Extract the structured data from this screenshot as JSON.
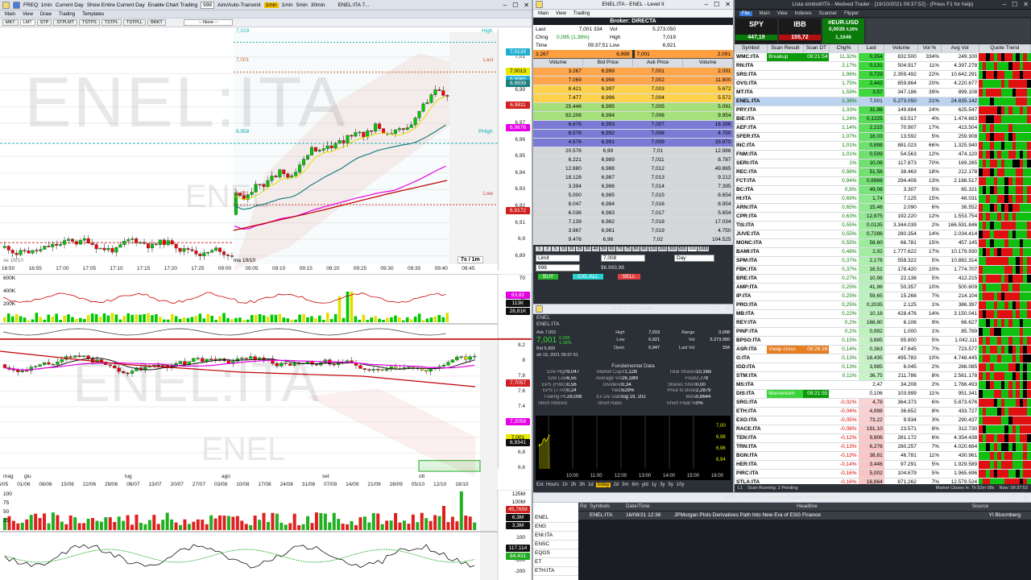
{
  "colors": {
    "up": "#00c800",
    "down": "#ff0000",
    "ma1": "#e0e000",
    "ma2": "#1f7f7f",
    "ma3": "#e600e6",
    "ma4": "#c00000"
  },
  "left": {
    "title": "ENEL:ITA 7...",
    "toolbar": [
      "FREQ: 1min",
      "Current Day",
      "Show Entire Current Day",
      "Enable Chart Trading",
      "998",
      "Aim/Auto-Transmit",
      "1min",
      "1min",
      "5min",
      "30min"
    ],
    "menu": [
      "Main",
      "View",
      "Draw",
      "Trading",
      "Templates"
    ],
    "ordertabs": [
      "MKT",
      "LMT",
      "STP",
      "STPLMT",
      "TSTPS",
      "TSTPL",
      "TSTPLL",
      "BRKT"
    ],
    "dropdown": "-- None --",
    "watermark": "ENEL:ITA",
    "watermark_sub": "ENEL",
    "chart1": {
      "y_ticks": [
        "7,01",
        "7",
        "6,99",
        "6,98",
        "6,97",
        "6,96",
        "6,95",
        "6,94",
        "6,93",
        "6,92",
        "6,91",
        "6,9",
        "6,89"
      ],
      "x_ticks": [
        "16:50",
        "16:55",
        "17:00",
        "17:05",
        "17:10",
        "17:15",
        "17:20",
        "17:25",
        "09:00",
        "09:05",
        "09:10",
        "09:15",
        "09:20",
        "09:25",
        "09:30",
        "09:35",
        "09:40",
        "09:45"
      ],
      "session_label": "ma 19/10",
      "prev_label": "ve 16/10",
      "tf_badge": "7s / 1m",
      "labels": {
        "high": "High",
        "last": "Last",
        "low": "Low",
        "pfhigh": "PHigh",
        "high_val": "7,019",
        "last_val": "7,001",
        "low_val": "6,921",
        "phigh_val": "6,958"
      },
      "price_boxes": [
        {
          "v": "7,0133",
          "c": "#20b0d0"
        },
        {
          "v": "7,0013",
          "c": "#e8e800",
          "t": "#000"
        },
        {
          "v": "6,9965",
          "c": "#20b0d0"
        },
        {
          "v": "6,9939",
          "c": "#1f7f7f"
        },
        {
          "v": "6,9811",
          "c": "#d02020"
        },
        {
          "v": "6,9676",
          "c": "#e600e6"
        },
        {
          "v": "6,9172",
          "c": "#d02020"
        }
      ],
      "vol_ticks": [
        "600K",
        "400K",
        "200K"
      ],
      "vol_boxes": [
        {
          "v": "63,82",
          "c": "#e000e0"
        },
        {
          "v": "113K",
          "c": "#111"
        },
        {
          "v": "28,81K",
          "c": "#111"
        }
      ],
      "osc_ticks": [
        "70",
        "30"
      ]
    },
    "chart2": {
      "y_ticks": [
        "8,2",
        "8",
        "7,8",
        "7,6",
        "7,4",
        "7,2",
        "7",
        "6,8",
        "6,6"
      ],
      "x_ticks": [
        "25/05",
        "01/06",
        "08/06",
        "15/06",
        "22/06",
        "29/06",
        "06/07",
        "13/07",
        "20/07",
        "27/07",
        "03/08",
        "10/08",
        "17/08",
        "24/08",
        "31/08",
        "07/09",
        "14/09",
        "21/09",
        "28/09",
        "05/10",
        "12/10",
        "19/10"
      ],
      "month_labels": [
        "mag",
        "giu",
        "lug",
        "ago",
        "set",
        "ott"
      ],
      "price_boxes": [
        {
          "v": "7,7057",
          "c": "#d02020"
        },
        {
          "v": "7,2058",
          "c": "#e600e6"
        },
        {
          "v": "7,001",
          "c": "#e8e800",
          "t": "#000"
        },
        {
          "v": "6,9341",
          "c": "#111"
        }
      ],
      "vol_ticks": [
        "100",
        "75",
        "50",
        "25"
      ],
      "vol_side": [
        "125M",
        "100M"
      ],
      "vol_boxes": [
        {
          "v": "45,7659",
          "c": "#d02020"
        },
        {
          "v": "6,3M",
          "c": "#111"
        },
        {
          "v": "3,3M",
          "c": "#111"
        }
      ],
      "osc_ticks": [
        "100",
        "0",
        "-100",
        "-200"
      ],
      "osc_boxes": [
        {
          "v": "117,114",
          "c": "#111"
        },
        {
          "v": "84,431",
          "c": "#22aa22"
        }
      ]
    }
  },
  "level2": {
    "title": "ENEL:ITA - ENEL - Level II",
    "menu": [
      "Main",
      "View",
      "Trading"
    ],
    "broker": "Broker: DIRECTA",
    "quote": {
      "last_l": "Last",
      "last": "7,001",
      "last_q": "334",
      "vol_l": "Vol",
      "vol": "5.273.050",
      "chg_l": "Chng",
      "chg": "0,095 (1,38%)",
      "high_l": "High",
      "high": "7,019",
      "time_l": "Time",
      "time": "09:37:51",
      "low_l": "Low",
      "low": "6,921"
    },
    "inside": {
      "bid_sz": "3.267",
      "bid": "6,999",
      "ask": "7,001",
      "ask_sz": "2.091"
    },
    "headers": [
      "Volume",
      "Bid Price",
      "Ask Price",
      "Volume"
    ],
    "rows": [
      [
        "3.267",
        "6,999",
        "7,001",
        "2.091",
        "#ffa64d",
        "#ffa64d"
      ],
      [
        "7.069",
        "6,998",
        "7,002",
        "11.800",
        "#ffa64d",
        "#ffa64d"
      ],
      [
        "8.421",
        "6,997",
        "7,003",
        "5.672",
        "#ffd24d",
        "#ffd24d"
      ],
      [
        "7.477",
        "6,996",
        "7,004",
        "5.572",
        "#ffd24d",
        "#ffd24d"
      ],
      [
        "25.446",
        "6,995",
        "7,005",
        "5.091",
        "#a6e07a",
        "#a6e07a"
      ],
      [
        "92.206",
        "6,994",
        "7,006",
        "9.954",
        "#a6e07a",
        "#a6e07a"
      ],
      [
        "6.676",
        "6,993",
        "7,007",
        "16.396",
        "#7b7bd6",
        "#7b7bd6"
      ],
      [
        "6.576",
        "6,992",
        "7,008",
        "4.750",
        "#7b7bd6",
        "#7b7bd6"
      ],
      [
        "4.576",
        "6,991",
        "7,009",
        "33.970",
        "#7b7bd6",
        "#7b7bd6"
      ],
      [
        "20.576",
        "6,99",
        "7,01",
        "12.986",
        "#d4d6da",
        "#d4d6da"
      ],
      [
        "6.221",
        "6,989",
        "7,011",
        "8.787",
        "#d4d6da",
        "#d4d6da"
      ],
      [
        "12.680",
        "6,988",
        "7,012",
        "49.865",
        "#d4d6da",
        "#d4d6da"
      ],
      [
        "18.128",
        "6,987",
        "7,013",
        "9.212",
        "#d4d6da",
        "#d4d6da"
      ],
      [
        "3.394",
        "6,986",
        "7,014",
        "7.395",
        "#d4d6da",
        "#d4d6da"
      ],
      [
        "5.000",
        "6,985",
        "7,015",
        "8.654",
        "#d4d6da",
        "#d4d6da"
      ],
      [
        "8.047",
        "6,984",
        "7,016",
        "8.954",
        "#d4d6da",
        "#d4d6da"
      ],
      [
        "6.036",
        "6,983",
        "7,017",
        "5.654",
        "#d4d6da",
        "#d4d6da"
      ],
      [
        "7.139",
        "6,982",
        "7,018",
        "17.034",
        "#d4d6da",
        "#d4d6da"
      ],
      [
        "3.967",
        "6,981",
        "7,019",
        "4.750",
        "#d4d6da",
        "#d4d6da"
      ],
      [
        "9.476",
        "6,98",
        "7,02",
        "104.525",
        "#d4d6da",
        "#d4d6da"
      ]
    ],
    "qty_buttons": [
      "1",
      "2",
      "5",
      "10",
      "20",
      "25",
      "30",
      "40",
      "50",
      "60",
      "70",
      "75",
      "80",
      "90",
      "100",
      "200",
      "300",
      "500",
      "998",
      "1000"
    ],
    "order": {
      "type": "Limit",
      "price": "7,008",
      "qty": "998",
      "amount": "$6.993,98",
      "tif": "Day",
      "buy": "BUY",
      "cxl": "CXL ALL",
      "sell": "SELL"
    }
  },
  "details": {
    "title": "ENEL:ITA Details",
    "sym1": "ENEL",
    "sym2": "ENEL:ITA",
    "last": "7,001",
    "chg": "0,095",
    "chgp": "1,38%",
    "ask": "Ask 7,001",
    "bid": "Bid 6,999",
    "date": "ott 19, 2021 09:37:51",
    "stats": [
      [
        "High",
        "7,019",
        "Range",
        "0,098"
      ],
      [
        "Low",
        "6,921",
        "Vol",
        "5.273.050"
      ],
      [
        "Open",
        "6,947",
        "Last Vol",
        "334"
      ]
    ],
    "fund_title": "Fundamental Data",
    "fund": [
      [
        "52w High",
        "9,047",
        "Market Cap",
        "71,12B",
        "Total Shares",
        "10,16B"
      ],
      [
        "52w Low",
        "6,55",
        "Average Vol",
        "26,18M",
        "Float",
        "7,778"
      ],
      [
        "EPS (FWD)",
        "0,56",
        "Dividend",
        "0,34",
        "Shares Short",
        "0,00"
      ],
      [
        "EPS (TTM)",
        "0,24",
        "Yield",
        "529%",
        "Price to Book",
        "2,2879"
      ],
      [
        "Trailing PE",
        "29,008",
        "Ex Div Date",
        "lug 19, 202",
        "Beta",
        "0,8644"
      ],
      [
        "Short Interest",
        "",
        "Short Ratio",
        "",
        "Short Float %",
        "0%"
      ]
    ],
    "mini_y": [
      "7,00",
      "6,98",
      "6,96",
      "6,94"
    ],
    "mini_x": [
      "10:00",
      "11:00",
      "12:00",
      "13:00",
      "14:00",
      "15:00",
      "16:00"
    ],
    "ranges": [
      "Ext. Hours",
      "1h",
      "2h",
      "3h",
      "1d",
      "today",
      "2d",
      "3m",
      "6m",
      "ytd",
      "1y",
      "3y",
      "5y",
      "10y"
    ]
  },
  "news": {
    "title": "ENEL:ITA News: 1 Stories shown - Medved Trader",
    "symbols": [
      "ENEL",
      "ENG",
      "ENI:ITA",
      "ENSC",
      "EQOS",
      "ET",
      "ETH:ITA"
    ],
    "headers": [
      "Rd",
      "Symbols",
      "Date/Time",
      "Headline",
      "Source"
    ],
    "row": {
      "sym": "ENEL:ITA",
      "dt": "16/08/21 12:36",
      "headline": "JPMorgan Plots Derivatives Path Into New Era of ESG Finance",
      "source": "YI Bloomberg"
    }
  },
  "scanner": {
    "title": "Lista simboli/ITA - Medved Trader - [19/10/2021 09:37:52] - (Press F1 for help)",
    "menu": [
      "File",
      "Main",
      "View",
      "Indexes",
      "Scanner",
      "Flipper"
    ],
    "tickers": [
      {
        "sym": "SPY",
        "val": "447,19",
        "bg": "#1a1a1a"
      },
      {
        "sym": "IBB",
        "val": "155,72",
        "bg": "#1a1a1a"
      },
      {
        "sym": "#EUR.USD",
        "val": "0,0035",
        "sub": "1,1646",
        "pct": "0,30%",
        "bg": "#0a7a0a"
      }
    ],
    "headers": [
      "Symbol",
      "Scan Result",
      "Scan DT",
      "Chg%",
      "Last",
      "Volume",
      "Vol %",
      "Avg Vol",
      "Quote Trend"
    ],
    "rows": [
      [
        "WMC:ITA",
        "Breakup",
        "09:21:54",
        "11,32%",
        "0,354",
        "832.500",
        "334%",
        "249.100"
      ],
      [
        "RN:ITA",
        "",
        "",
        "2,17%",
        "0,131",
        "504.917",
        "11%",
        "4.397.278"
      ],
      [
        "SRS:ITA",
        "",
        "",
        "1,96%",
        "0,729",
        "2.359.492",
        "22%",
        "10.642.291"
      ],
      [
        "OVS:ITA",
        "",
        "",
        "1,75%",
        "2,442",
        "859.864",
        "20%",
        "4.220.677"
      ],
      [
        "MT:ITA",
        "",
        "",
        "1,59%",
        "3,57",
        "347.186",
        "39%",
        "899.108"
      ],
      [
        "ENEL:ITA",
        "",
        "",
        "1,38%",
        "7,001",
        "5.273.050",
        "21%",
        "24.835.142"
      ],
      [
        "PRY:ITA",
        "",
        "",
        "1,33%",
        "31,96",
        "149.884",
        "24%",
        "625.547"
      ],
      [
        "BIE:ITA",
        "",
        "",
        "1,24%",
        "0,1225",
        "63.517",
        "4%",
        "1.474.683"
      ],
      [
        "AEF:ITA",
        "",
        "",
        "1,14%",
        "2,215",
        "70.907",
        "17%",
        "413.504"
      ],
      [
        "SFER:ITA",
        "",
        "",
        "1,07%",
        "18,03",
        "13.592",
        "5%",
        "259.908"
      ],
      [
        "INC:ITA",
        "",
        "",
        "1,01%",
        "0,898",
        "881.023",
        "66%",
        "1.325.940"
      ],
      [
        "FNM:ITA",
        "",
        "",
        "1,01%",
        "0,599",
        "54.563",
        "12%",
        "474.120"
      ],
      [
        "SERI:ITA",
        "",
        "",
        "1%",
        "10,06",
        "117.873",
        "70%",
        "169.265"
      ],
      [
        "REC:ITA",
        "",
        "",
        "0,98%",
        "51,56",
        "38.463",
        "18%",
        "212.178"
      ],
      [
        "FCT:ITA",
        "",
        "",
        "0,94%",
        "0,6968",
        "294.408",
        "13%",
        "2.188.517"
      ],
      [
        "BC:ITA",
        "",
        "",
        "0,9%",
        "49,08",
        "3.307",
        "5%",
        "65.321"
      ],
      [
        "HI:ITA",
        "",
        "",
        "0,69%",
        "1,74",
        "7.125",
        "15%",
        "48.031"
      ],
      [
        "ARN:ITA",
        "",
        "",
        "0,65%",
        "15,46",
        "2.090",
        "6%",
        "36.552"
      ],
      [
        "CPR:ITA",
        "",
        "",
        "0,63%",
        "12,875",
        "192.220",
        "12%",
        "1.553.754"
      ],
      [
        "TIS:ITA",
        "",
        "",
        "0,55%",
        "0,0135",
        "3.344.039",
        "2%",
        "166.591.846"
      ],
      [
        "JUVE:ITA",
        "",
        "",
        "0,55%",
        "0,7286",
        "280.354",
        "14%",
        "2.034.414"
      ],
      [
        "MONC:ITA",
        "",
        "",
        "0,55%",
        "58,60",
        "66.781",
        "15%",
        "457.145"
      ],
      [
        "BAMI:ITA",
        "",
        "",
        "0,48%",
        "2,92",
        "1.777.622",
        "17%",
        "10.179.930"
      ],
      [
        "SPM:ITA",
        "",
        "",
        "0,37%",
        "2,176",
        "558.322",
        "5%",
        "10.882.314"
      ],
      [
        "FBK:ITA",
        "",
        "",
        "0,37%",
        "16,51",
        "178.420",
        "10%",
        "1.774.707"
      ],
      [
        "BRE:ITA",
        "",
        "",
        "0,27%",
        "10,98",
        "22.138",
        "5%",
        "412.215"
      ],
      [
        "AMP:ITA",
        "",
        "",
        "0,25%",
        "41,96",
        "50.357",
        "10%",
        "500.609"
      ],
      [
        "IP:ITA",
        "",
        "",
        "0,25%",
        "59,65",
        "15.268",
        "7%",
        "214.104"
      ],
      [
        "PRO:ITA",
        "",
        "",
        "0,25%",
        "0,2035",
        "2.125",
        "1%",
        "386.397"
      ],
      [
        "MB:ITA",
        "",
        "",
        "0,22%",
        "10,18",
        "428.476",
        "14%",
        "3.150.041"
      ],
      [
        "REY:ITA",
        "",
        "",
        "0,2%",
        "168,80",
        "6.106",
        "9%",
        "66.627"
      ],
      [
        "PINF:ITA",
        "",
        "",
        "0,2%",
        "0,992",
        "1.000",
        "1%",
        "85.789"
      ],
      [
        "BPSO:ITA",
        "",
        "",
        "0,15%",
        "3,885",
        "95.800",
        "5%",
        "1.042.111"
      ],
      [
        "ASR:ITA",
        "Vwap cross",
        "09:28:26",
        "0,14%",
        "0,363",
        "47.645",
        "7%",
        "723.577"
      ],
      [
        "G:ITA",
        "",
        "",
        "0,13%",
        "18,435",
        "495.783",
        "10%",
        "4.748.445"
      ],
      [
        "IGD:ITA",
        "",
        "",
        "0,13%",
        "3,985",
        "6.045",
        "2%",
        "286.085"
      ],
      [
        "STM:ITA",
        "",
        "",
        "0,11%",
        "36,75",
        "211.786",
        "8%",
        "2.561.178"
      ],
      [
        "MS:ITA",
        "",
        "",
        "",
        "2,47",
        "34.208",
        "2%",
        "1.766.493"
      ],
      [
        "DIS:ITA",
        "Momentum",
        "09:21:55",
        "",
        "0,106",
        "103.999",
        "11%",
        "951.341"
      ],
      [
        "SRG:ITA",
        "",
        "",
        "-0,02%",
        "4,78",
        "364.373",
        "6%",
        "5.873.676"
      ],
      [
        "ETH:ITA",
        "",
        "",
        "-0,04%",
        "4,998",
        "36.652",
        "8%",
        "433.727"
      ],
      [
        "EXO:ITA",
        "",
        "",
        "-0,05%",
        "73,22",
        "9.934",
        "3%",
        "290.437"
      ],
      [
        "RACE:ITA",
        "",
        "",
        "-0,08%",
        "191,10",
        "23.571",
        "8%",
        "312.730"
      ],
      [
        "TEN:ITA",
        "",
        "",
        "-0,12%",
        "9,806",
        "281.172",
        "6%",
        "4.354.438"
      ],
      [
        "TRN:ITA",
        "",
        "",
        "-0,13%",
        "6,276",
        "280.257",
        "7%",
        "4.020.664"
      ],
      [
        "BGN:ITA",
        "",
        "",
        "-0,13%",
        "38,81",
        "46.781",
        "11%",
        "430.961"
      ],
      [
        "HER:ITA",
        "",
        "",
        "-0,14%",
        "3,446",
        "97.291",
        "5%",
        "1.929.589"
      ],
      [
        "PIRC:ITA",
        "",
        "",
        "-0,16%",
        "5,002",
        "104.679",
        "5%",
        "1.965.696"
      ],
      [
        "STLA:ITA",
        "",
        "",
        "-0,16%",
        "16,864",
        "871.262",
        "7%",
        "12.579.524"
      ],
      [
        "CASS:ITA",
        "",
        "",
        "-0,21%",
        "7,10",
        "123.843",
        "20%",
        "613.097"
      ],
      [
        "UCG:ITA",
        "",
        "",
        "-0,24%",
        "11,662",
        "2.594.299",
        "16%",
        "17.129.524"
      ]
    ],
    "status": {
      "a": "L1",
      "b": "Scan Running: 2 Pending",
      "c": "Market Closes in: 7h 52m 08s",
      "d": "Now: 09:37:52"
    }
  }
}
